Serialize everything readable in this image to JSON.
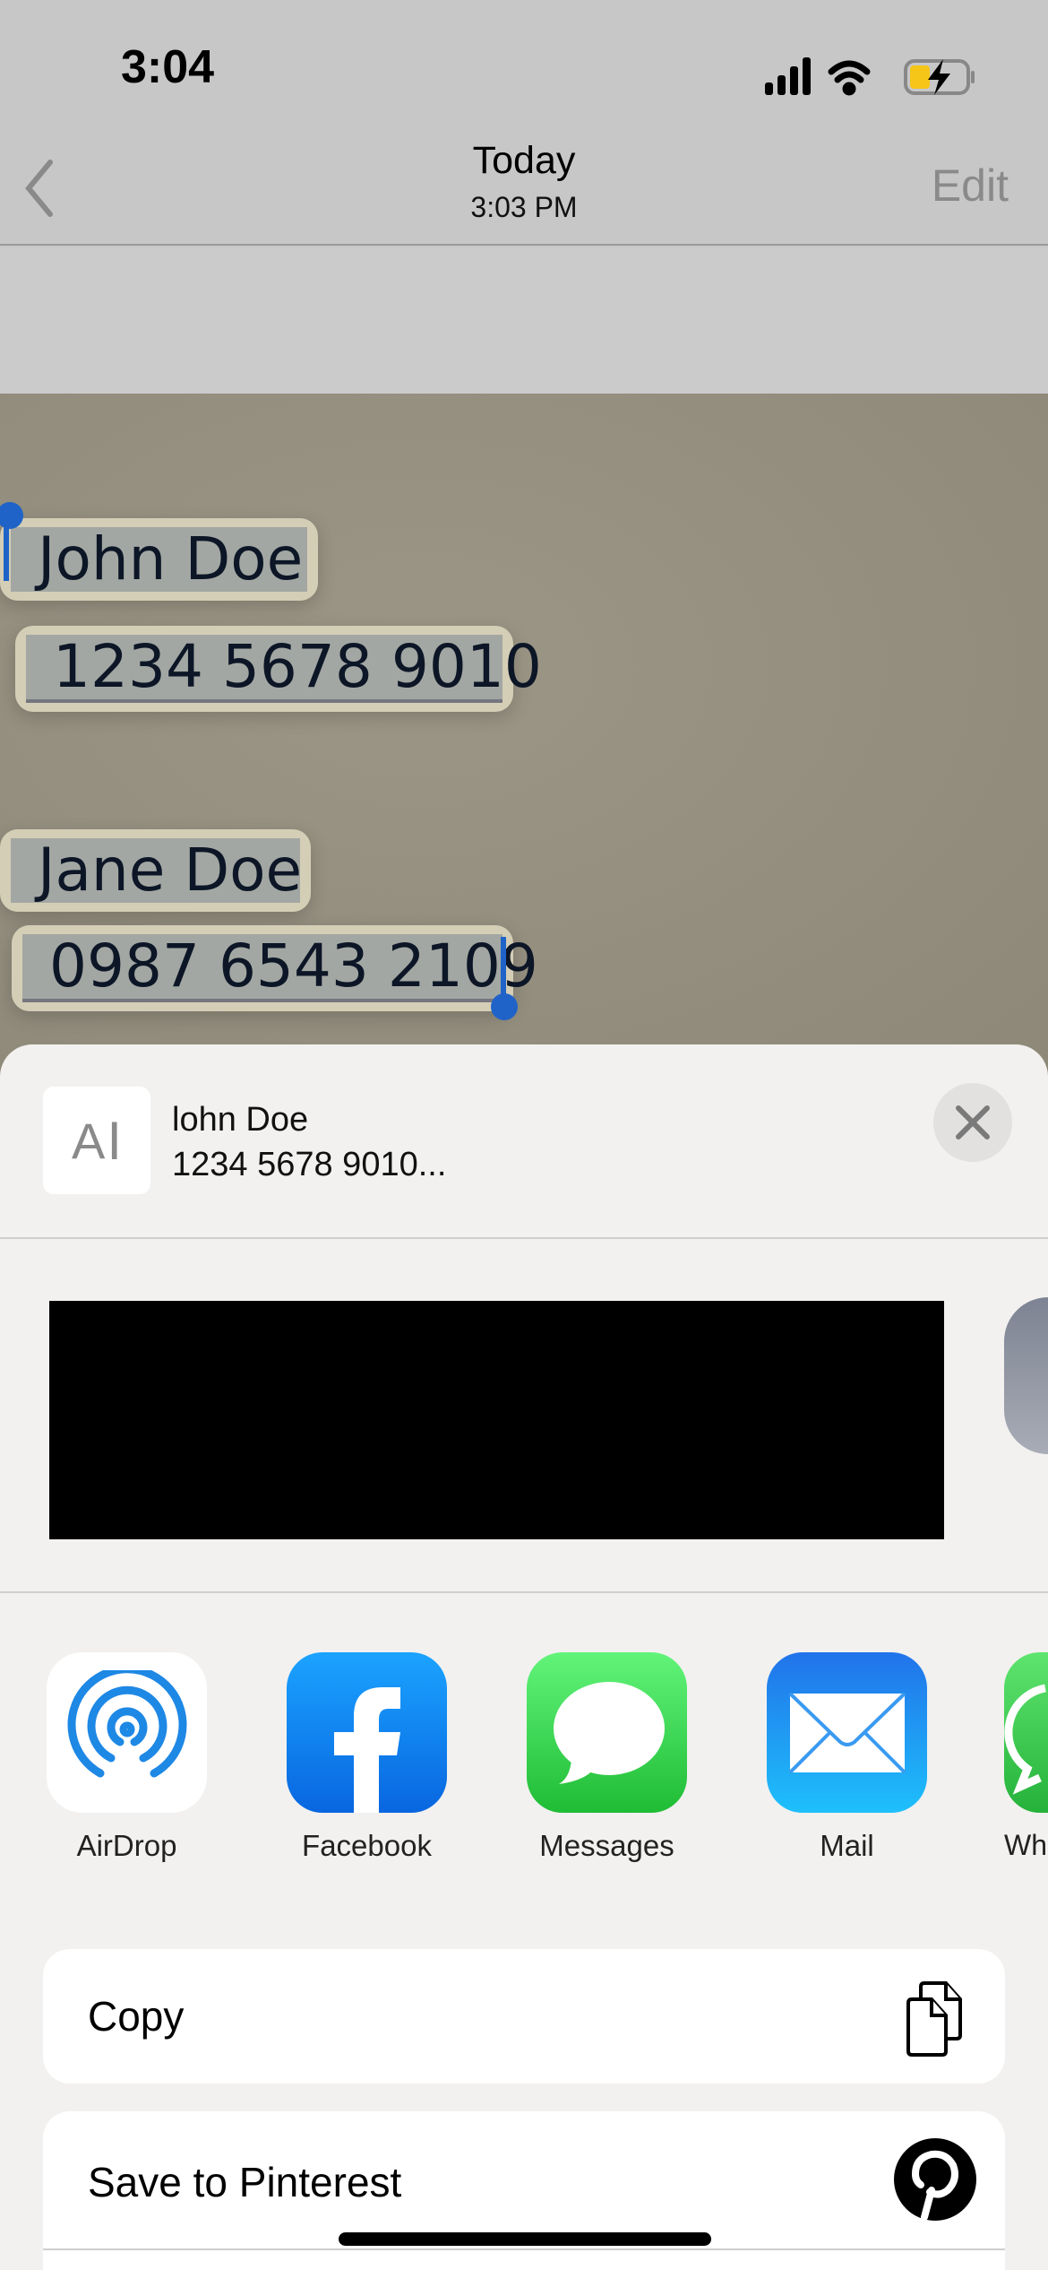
{
  "status_bar": {
    "time": "3:04",
    "icons": [
      "cellular-signal-icon",
      "wifi-icon",
      "battery-charging-icon"
    ],
    "battery_color": "#f5c518"
  },
  "nav": {
    "back_icon": "chevron-left-icon",
    "title": "Today",
    "subtitle": "3:03 PM",
    "edit_label": "Edit"
  },
  "photo_text": {
    "lines": [
      "John Doe",
      "1234 5678 9010",
      "Jane Doe",
      "0987 6543 2109"
    ],
    "selection_color": "#1f63c8"
  },
  "share_sheet": {
    "preview": {
      "icon": "text-cursor-icon",
      "icon_text": "A",
      "title": "lohn Doe",
      "subtitle": "1234 5678 9010..."
    },
    "close_icon": "close-icon",
    "apps": [
      {
        "label": "AirDrop",
        "icon": "airdrop-icon"
      },
      {
        "label": "Facebook",
        "icon": "facebook-icon"
      },
      {
        "label": "Messages",
        "icon": "messages-icon"
      },
      {
        "label": "Mail",
        "icon": "mail-icon"
      },
      {
        "label": "Wh",
        "icon": "whatsapp-icon"
      }
    ],
    "actions": [
      {
        "label": "Copy",
        "icon": "copy-icon"
      },
      {
        "label": "Save to Pinterest",
        "icon": "pinterest-icon"
      }
    ]
  }
}
